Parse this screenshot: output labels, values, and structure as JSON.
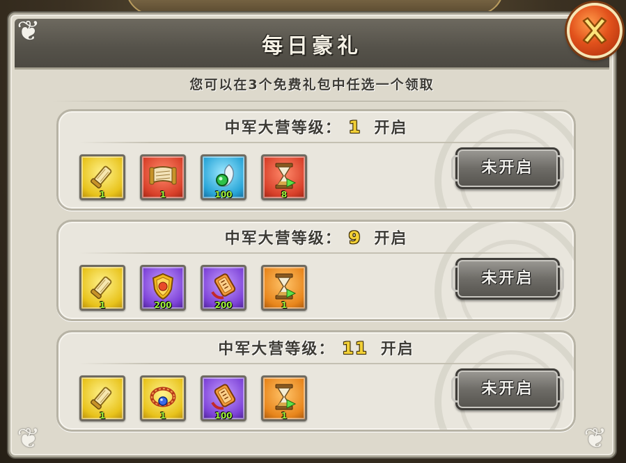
{
  "dialog": {
    "title": "每日豪礼",
    "subtitle": "您可以在3个免费礼包中任选一个领取"
  },
  "colors": {
    "level_number": "#f2d037",
    "item_count": "#9ef23c",
    "close_button": "#e2521c"
  },
  "tiers": [
    {
      "label_prefix": "中军大营等级：",
      "level": "1",
      "label_suffix": "开启",
      "button_label": "未开启",
      "items": [
        {
          "icon": "scroll-roll-icon",
          "bg": "yellow",
          "count": "1"
        },
        {
          "icon": "open-scroll-icon",
          "bg": "red",
          "count": "1"
        },
        {
          "icon": "jade-orb-icon",
          "bg": "blue",
          "count": "100"
        },
        {
          "icon": "hourglass-icon",
          "bg": "red",
          "count": "8"
        }
      ]
    },
    {
      "label_prefix": "中军大营等级：",
      "level": "9",
      "label_suffix": "开启",
      "button_label": "未开启",
      "items": [
        {
          "icon": "scroll-roll-icon",
          "bg": "yellow",
          "count": "1"
        },
        {
          "icon": "golden-shield-icon",
          "bg": "purple",
          "count": "200"
        },
        {
          "icon": "token-plaque-icon",
          "bg": "purple",
          "count": "200"
        },
        {
          "icon": "hourglass-icon",
          "bg": "orange",
          "count": "1"
        }
      ]
    },
    {
      "label_prefix": "中军大营等级：",
      "level": "11",
      "label_suffix": "开启",
      "button_label": "未开启",
      "items": [
        {
          "icon": "scroll-roll-icon",
          "bg": "yellow",
          "count": "1"
        },
        {
          "icon": "gem-bracelet-icon",
          "bg": "yellow",
          "count": "1"
        },
        {
          "icon": "token-plaque-icon",
          "bg": "purple",
          "count": "100"
        },
        {
          "icon": "hourglass-icon",
          "bg": "orange",
          "count": "1"
        }
      ]
    }
  ]
}
